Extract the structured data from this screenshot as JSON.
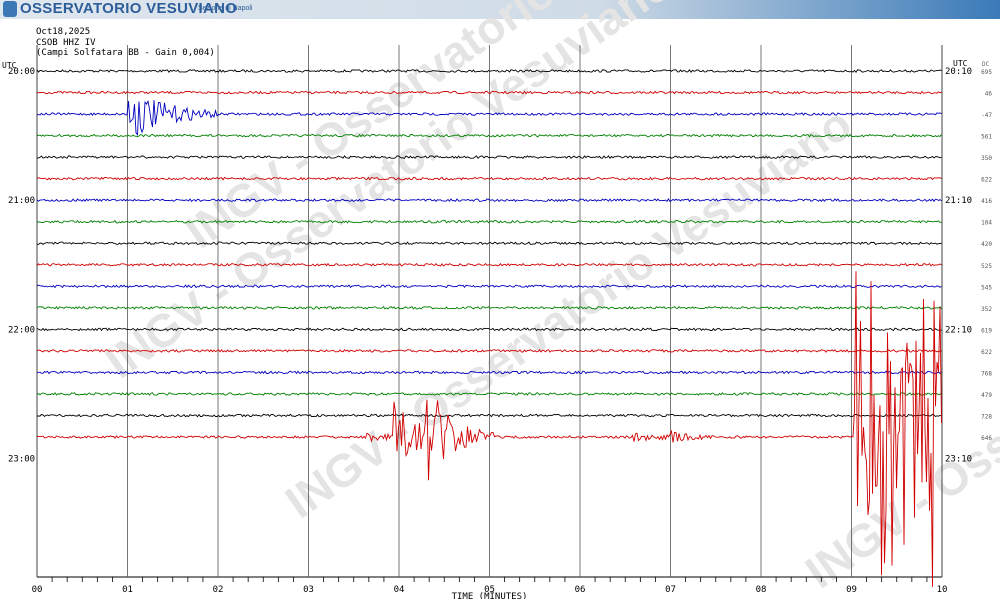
{
  "header": {
    "title": "OSSERVATORIO VESUVIANO",
    "subtitle": "Sezione di Napoli",
    "logo_text": "INGV"
  },
  "info": {
    "date": "Oct18,2025",
    "station": "CSOB HHZ IV",
    "description": "(Campi Solfatara BB  - Gain 0,004)"
  },
  "watermark": "INGV - Osservatorio Vesuviano",
  "chart_data": {
    "type": "line",
    "title": "",
    "xlabel": "TIME (MINUTES)",
    "x_ticks": [
      "00",
      "01",
      "02",
      "03",
      "04",
      "05",
      "06",
      "07",
      "08",
      "09",
      "10"
    ],
    "xlim": [
      0,
      10
    ],
    "left_axis_unit": "UTC",
    "right_axis_unit": "UTC",
    "left_time_labels": [
      "20:00",
      "21:00",
      "22:00",
      "23:00"
    ],
    "right_time_labels": [
      "20:10",
      "21:10",
      "22:10",
      "23:10"
    ],
    "right_column_header": "DC",
    "dc_offsets": [
      "695",
      "46",
      "-47",
      "561",
      "350",
      "622",
      "416",
      "104",
      "420",
      "525",
      "545",
      "352",
      "619",
      "622",
      "768",
      "479",
      "728",
      "646"
    ],
    "trace_colors": [
      "#000000",
      "#d00000",
      "#0000c0",
      "#008000"
    ],
    "grid": true
  }
}
